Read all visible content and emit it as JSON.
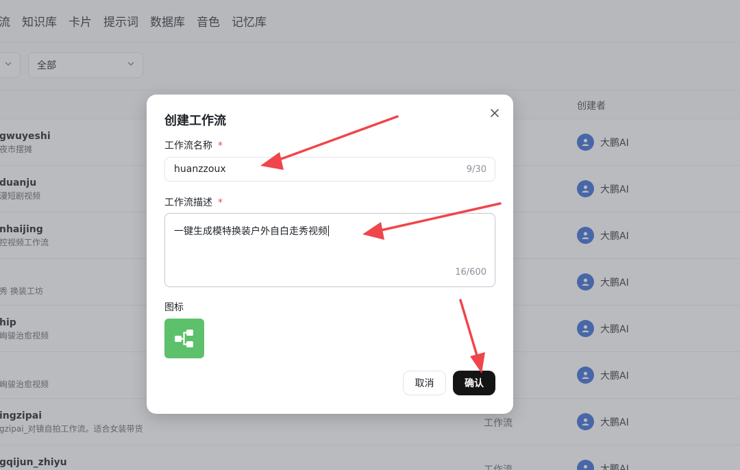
{
  "nav": {
    "items": [
      "流",
      "知识库",
      "卡片",
      "提示词",
      "数据库",
      "音色",
      "记忆库"
    ]
  },
  "filters": {
    "status_select": "全部"
  },
  "table": {
    "col_creator": "创建者",
    "rows": [
      {
        "name": "gwuyeshi",
        "desc": "夜市摆摊",
        "type": "",
        "creator": "大鹏AI"
      },
      {
        "name": "duanju",
        "desc": "漫短剧视频",
        "type": "",
        "creator": "大鹏AI"
      },
      {
        "name": "nhaijing",
        "desc": "控视频工作流",
        "type": "",
        "creator": "大鹏AI"
      },
      {
        "name": "",
        "desc": "秀 换装工坊",
        "type": "",
        "creator": "大鹏AI"
      },
      {
        "name": "hip",
        "desc": "峋骏治愈视频",
        "type": "",
        "creator": "大鹏AI"
      },
      {
        "name": "",
        "desc": "峋骏治愈视频",
        "type": "",
        "creator": "大鹏AI"
      },
      {
        "name": "ingzipai",
        "desc": "gzipai_对镜自拍工作流。适合女装带货",
        "type": "工作流",
        "creator": "大鹏AI"
      },
      {
        "name": "gqijun_zhiyu",
        "desc": "",
        "type": "工作流",
        "creator": "大鹏AI"
      }
    ]
  },
  "modal": {
    "title": "创建工作流",
    "name_label": "工作流名称",
    "name_value": "huanzzoux",
    "name_count": "9/30",
    "desc_label": "工作流描述",
    "desc_value": "一键生成模特换装户外自白走秀视频",
    "desc_count": "16/600",
    "icon_label": "图标",
    "cancel_label": "取消",
    "confirm_label": "确认",
    "required_mark": "*"
  },
  "colors": {
    "accent_confirm": "#141414",
    "icon_tile": "#5cc16a",
    "avatar": "#3c6fd9",
    "required": "#e5484d",
    "annotation_arrow": "#f0454b"
  }
}
